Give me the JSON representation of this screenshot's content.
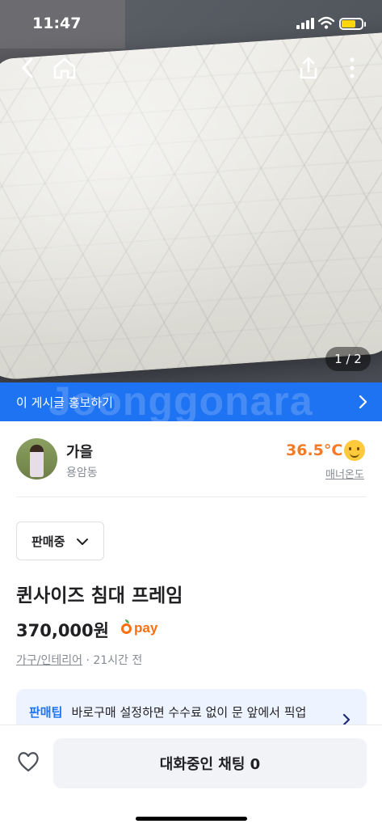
{
  "status_bar": {
    "time": "11:47"
  },
  "listing_image": {
    "page_indicator": "1 / 2"
  },
  "promo": {
    "text": "이 게시글 홍보하기",
    "watermark": "Joonggonara"
  },
  "seller": {
    "name": "가을",
    "location": "용암동",
    "manner_temp": "36.5°C",
    "manner_label": "매너온도",
    "accent_color": "#f57a24"
  },
  "listing": {
    "status": "판매중",
    "title": "퀸사이즈 침대 프레임",
    "price": "370,000원",
    "pay_label": "pay",
    "category": "가구/인테리어",
    "separator": " · ",
    "time_ago": "21시간 전"
  },
  "tip": {
    "label": "판매팁",
    "text": "바로구매 설정하면 수수료 없이 문 앞에서 픽업"
  },
  "bottom": {
    "chat_button": "대화중인 채팅 0"
  },
  "icons": [
    "back-icon",
    "home-icon",
    "share-icon",
    "more-icon",
    "chevron-right-icon",
    "chevron-down-icon",
    "heart-icon",
    "smile-face-icon"
  ],
  "colors": {
    "brand_blue": "#1e73f2",
    "orange": "#ff6f0f"
  }
}
